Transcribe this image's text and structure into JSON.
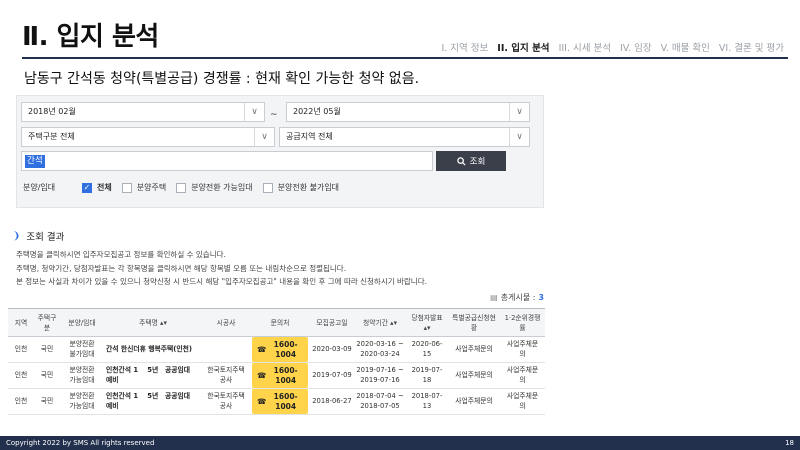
{
  "slide": {
    "title": "Ⅱ. 입지 분석",
    "nav": [
      "I. 지역 정보",
      "II. 입지 분석",
      "III. 시세 분석",
      "IV. 임장",
      "V. 매물 확인",
      "VI. 결론 및 평가"
    ],
    "headline": "남동구 간석동 청약(특별공급) 경쟁률 : 현재 확인 가능한 청약 없음."
  },
  "search": {
    "date_from": "2018년 02월",
    "date_to": "2022년 05월",
    "tilde": "~",
    "housing_type": "주택구분 전체",
    "region": "공급지역 전체",
    "query": "간석",
    "button_label": "조회",
    "filter_label": "분양/임대",
    "filters": [
      {
        "label": "전체",
        "checked": true
      },
      {
        "label": "분양주택",
        "checked": false
      },
      {
        "label": "분양전환 가능임대",
        "checked": false
      },
      {
        "label": "분양전환 불가임대",
        "checked": false
      }
    ]
  },
  "results": {
    "title": "조회 결과",
    "notes": [
      "주택명을 클릭하시면 입주자모집공고 정보를 확인하실 수 있습니다.",
      "주택명, 청약기간, 당첨자발표는 각 항목명을 클릭하시면 해당 항목별 오름 또는 내림차순으로 정렬됩니다.",
      "본 정보는 사실과 차이가 있을 수 있으니 청약신청 시 반드시 해당 \"입주자모집공고\" 내용을 확인 후 그에 따라 신청하시기 바랍니다."
    ],
    "total_label": "총게시물 :",
    "total_count": "3",
    "columns": [
      "지역",
      "주택구분",
      "분양/임대",
      "주택명 ▴▾",
      "시공사",
      "문의처",
      "모집공고일",
      "청약기간 ▴▾",
      "당첨자발표 ▴▾",
      "특별공급신청현황",
      "1·2순위경쟁률"
    ],
    "rows": [
      {
        "region": "인천",
        "type": "국민",
        "supply": "분양전환\n불가임대",
        "name": "간석 한신더휴 행복주택(인천)",
        "builder": "",
        "phone": "1600-1004",
        "notice": "2020-03-09",
        "period": "2020-03-16 ~\n2020-03-24",
        "winner": "2020-06-15",
        "special": "사업주체문의",
        "rank": "사업주체문\n의"
      },
      {
        "region": "인천",
        "type": "국민",
        "supply": "분양전환\n가능임대",
        "name": "인천간석 1　 5년　공공임대\n예비",
        "builder": "한국토지주택\n공사",
        "phone": "1600-1004",
        "notice": "2019-07-09",
        "period": "2019-07-16 ~\n2019-07-16",
        "winner": "2019-07-18",
        "special": "사업주체문의",
        "rank": "사업주체문\n의"
      },
      {
        "region": "인천",
        "type": "국민",
        "supply": "분양전환\n가능임대",
        "name": "인천간석 1　 5년　공공임대\n예비",
        "builder": "한국토지주택\n공사",
        "phone": "1600-1004",
        "notice": "2018-06-27",
        "period": "2018-07-04 ~\n2018-07-05",
        "winner": "2018-07-13",
        "special": "사업주체문의",
        "rank": "사업주체문\n의"
      }
    ]
  },
  "footer": {
    "copyright": "Copyright 2022 by SMS All rights reserved",
    "page": "18"
  }
}
